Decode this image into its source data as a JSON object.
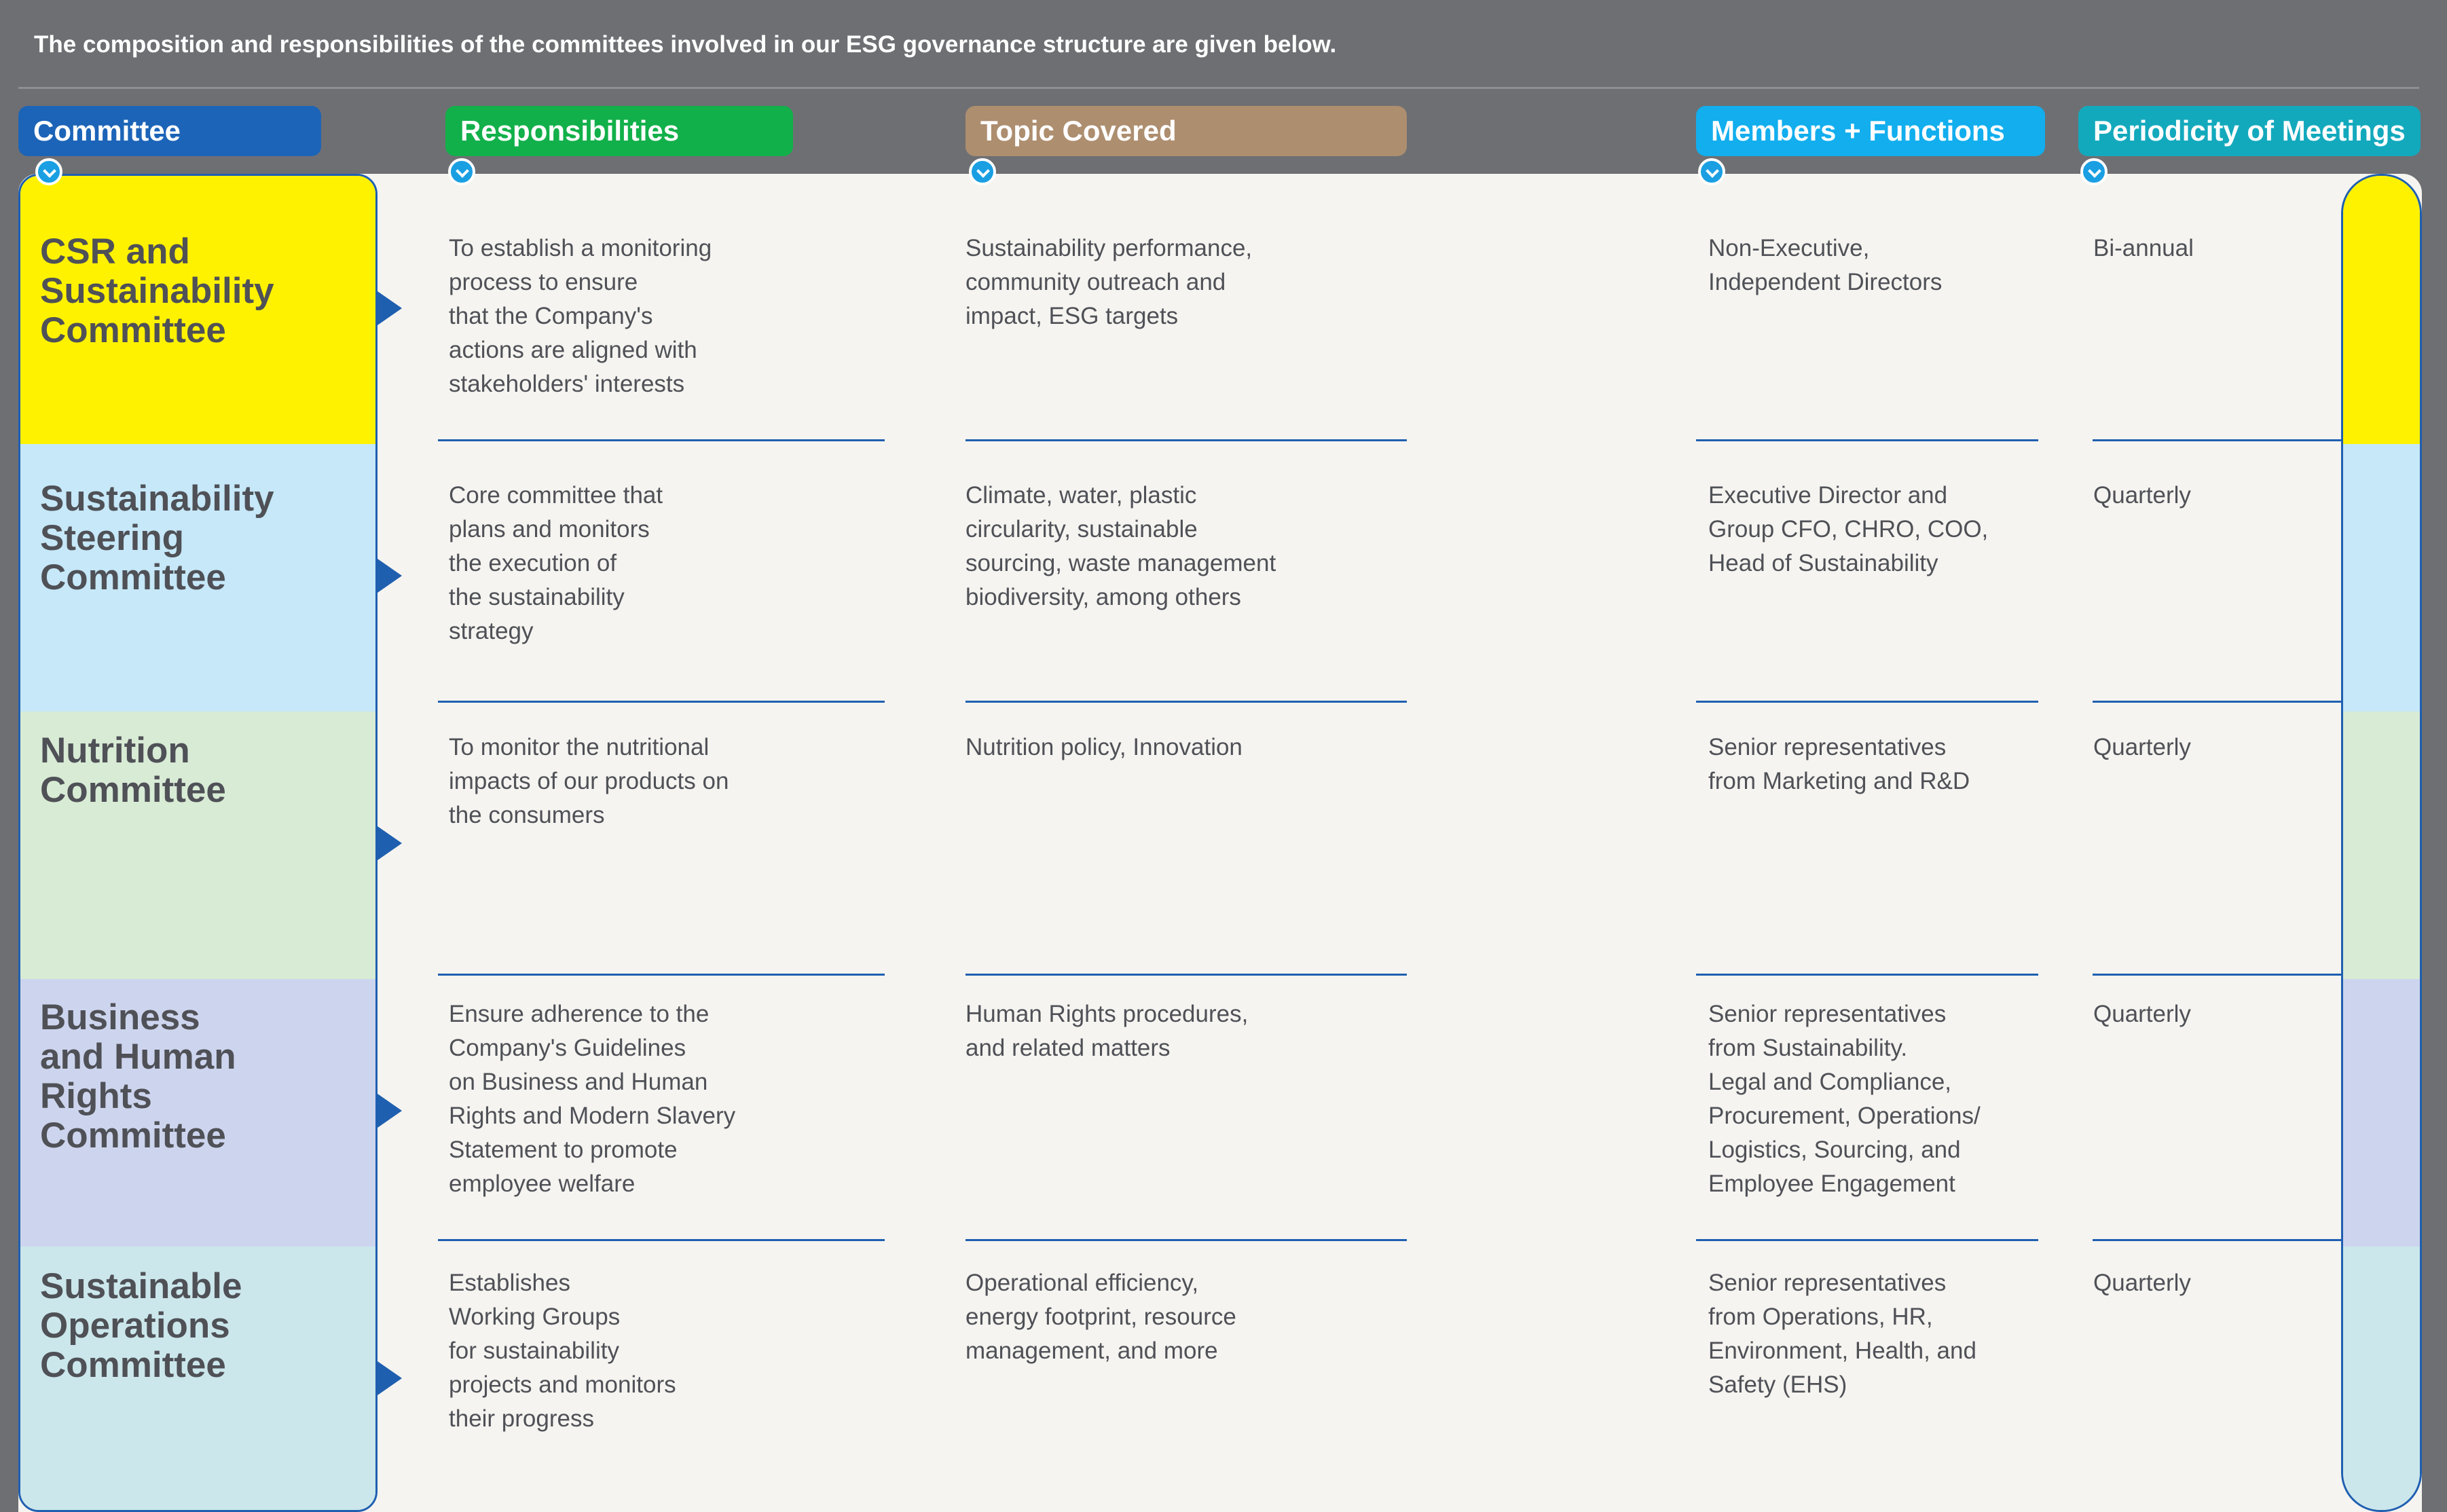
{
  "intro_text": "The composition and responsibilities of the committees involved in our ESG governance structure are given below.",
  "columns": [
    {
      "label": "Committee",
      "color": "#1c64b8"
    },
    {
      "label": "Responsibilities",
      "color": "#12b04a"
    },
    {
      "label": "Topic Covered",
      "color": "#ad8e6f"
    },
    {
      "label": "Members + Functions",
      "color": "#12aeee"
    },
    {
      "label": "Periodicity of Meetings",
      "color": "#13a9bd"
    }
  ],
  "rows": [
    {
      "color": "#fff200",
      "committee": [
        "CSR and",
        "Sustainability",
        "Committee"
      ],
      "responsibilities": [
        "To establish a monitoring",
        "process to ensure",
        "that the Company's",
        "actions are aligned with",
        "stakeholders' interests"
      ],
      "topics": [
        "Sustainability performance,",
        "community outreach and",
        "impact, ESG targets"
      ],
      "members": [
        "Non-Executive,",
        "Independent Directors"
      ],
      "periodicity": "Bi-annual"
    },
    {
      "color": "#c6e8f8",
      "committee": [
        "Sustainability",
        "Steering",
        "Committee"
      ],
      "responsibilities": [
        "Core committee that",
        "plans and monitors",
        "the execution of",
        "the sustainability",
        "strategy"
      ],
      "topics": [
        "Climate, water, plastic",
        "circularity, sustainable",
        "sourcing, waste management",
        "biodiversity, among others"
      ],
      "members": [
        "Executive Director and",
        "Group CFO, CHRO, COO,",
        "Head of Sustainability"
      ],
      "periodicity": "Quarterly"
    },
    {
      "color": "#d8ebd5",
      "committee": [
        "Nutrition",
        "Committee"
      ],
      "responsibilities": [
        "To monitor the nutritional",
        "impacts of our products on",
        "the consumers"
      ],
      "topics": [
        "Nutrition policy, Innovation"
      ],
      "members": [
        "Senior representatives",
        "from Marketing and R&D"
      ],
      "periodicity": "Quarterly"
    },
    {
      "color": "#cdd5ee",
      "committee": [
        "Business",
        "and Human",
        "Rights",
        "Committee"
      ],
      "responsibilities": [
        "Ensure adherence to the",
        "Company's Guidelines",
        "on Business and Human",
        "Rights and Modern Slavery",
        "Statement to promote",
        "employee welfare"
      ],
      "topics": [
        "Human Rights procedures,",
        "and related matters"
      ],
      "members": [
        "Senior representatives",
        "from Sustainability.",
        "Legal and Compliance,",
        "Procurement, Operations/",
        "Logistics, Sourcing, and",
        "Employee Engagement"
      ],
      "periodicity": "Quarterly"
    },
    {
      "color": "#cbe7ec",
      "committee": [
        "Sustainable",
        "Operations",
        "Committee"
      ],
      "responsibilities": [
        "Establishes",
        "Working Groups",
        "for sustainability",
        "projects and monitors",
        "their progress"
      ],
      "topics": [
        "Operational efficiency,",
        "energy footprint, resource",
        "management, and more"
      ],
      "members": [
        "Senior representatives",
        "from Operations, HR,",
        "Environment, Health, and",
        "Safety (EHS)"
      ],
      "periodicity": "Quarterly"
    }
  ]
}
